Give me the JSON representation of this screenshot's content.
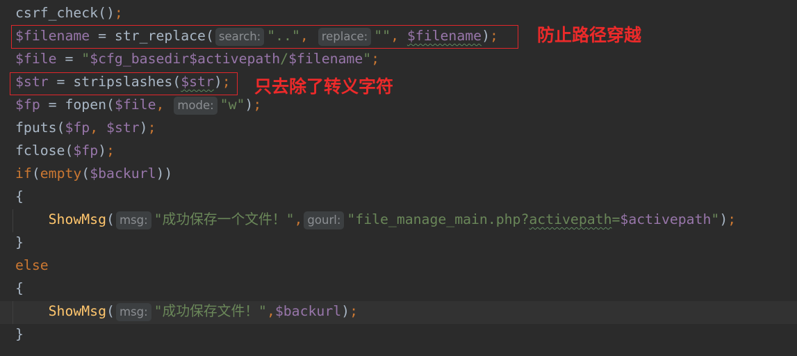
{
  "editor": {
    "theme": {
      "background": "#2b2b2b",
      "current_line": "#323232"
    },
    "lines": [
      {
        "tokens": [
          {
            "text": "csrf_check",
            "color": "#a9b7c6"
          },
          {
            "text": "()",
            "color": "#a9b7c6"
          },
          {
            "text": ";",
            "color": "#cc7832"
          }
        ]
      },
      {
        "tokens": [
          {
            "text": "$filename",
            "color": "#9876aa"
          },
          {
            "text": " = ",
            "color": "#a9b7c6"
          },
          {
            "text": "str_replace",
            "color": "#a9b7c6"
          },
          {
            "text": "(",
            "color": "#a9b7c6"
          },
          {
            "text": "search:",
            "hint": true
          },
          {
            "text": "\"..\"",
            "color": "#6a8759"
          },
          {
            "text": ", ",
            "color": "#cc7832"
          },
          {
            "text": "replace:",
            "hint": true
          },
          {
            "text": "\"\"",
            "color": "#6a8759"
          },
          {
            "text": ", ",
            "color": "#cc7832"
          },
          {
            "text": "$filename",
            "color": "#9876aa",
            "typo": true
          },
          {
            "text": ")",
            "color": "#a9b7c6"
          },
          {
            "text": ";",
            "color": "#cc7832"
          }
        ]
      },
      {
        "tokens": [
          {
            "text": "$file",
            "color": "#9876aa"
          },
          {
            "text": " = ",
            "color": "#a9b7c6"
          },
          {
            "text": "\"",
            "color": "#6a8759"
          },
          {
            "text": "$cfg_basedir",
            "color": "#9876aa"
          },
          {
            "text": "$activepath",
            "color": "#9876aa"
          },
          {
            "text": "/",
            "color": "#6a8759"
          },
          {
            "text": "$filename",
            "color": "#9876aa"
          },
          {
            "text": "\"",
            "color": "#6a8759"
          },
          {
            "text": ";",
            "color": "#cc7832"
          }
        ]
      },
      {
        "tokens": [
          {
            "text": "$str",
            "color": "#9876aa"
          },
          {
            "text": " = ",
            "color": "#a9b7c6"
          },
          {
            "text": "stripslashes",
            "color": "#a9b7c6"
          },
          {
            "text": "(",
            "color": "#a9b7c6"
          },
          {
            "text": "$str",
            "color": "#9876aa",
            "typo": true
          },
          {
            "text": ")",
            "color": "#a9b7c6"
          },
          {
            "text": ";",
            "color": "#cc7832"
          }
        ]
      },
      {
        "tokens": [
          {
            "text": "$fp",
            "color": "#9876aa"
          },
          {
            "text": " = ",
            "color": "#a9b7c6"
          },
          {
            "text": "fopen",
            "color": "#a9b7c6"
          },
          {
            "text": "(",
            "color": "#a9b7c6"
          },
          {
            "text": "$file",
            "color": "#9876aa"
          },
          {
            "text": ", ",
            "color": "#cc7832"
          },
          {
            "text": "mode:",
            "hint": true
          },
          {
            "text": "\"w\"",
            "color": "#6a8759"
          },
          {
            "text": ")",
            "color": "#a9b7c6"
          },
          {
            "text": ";",
            "color": "#cc7832"
          }
        ]
      },
      {
        "tokens": [
          {
            "text": "fputs",
            "color": "#a9b7c6"
          },
          {
            "text": "(",
            "color": "#a9b7c6"
          },
          {
            "text": "$fp",
            "color": "#9876aa"
          },
          {
            "text": ", ",
            "color": "#cc7832"
          },
          {
            "text": "$str",
            "color": "#9876aa"
          },
          {
            "text": ")",
            "color": "#a9b7c6"
          },
          {
            "text": ";",
            "color": "#cc7832"
          }
        ]
      },
      {
        "tokens": [
          {
            "text": "fclose",
            "color": "#a9b7c6"
          },
          {
            "text": "(",
            "color": "#a9b7c6"
          },
          {
            "text": "$fp",
            "color": "#9876aa"
          },
          {
            "text": ")",
            "color": "#a9b7c6"
          },
          {
            "text": ";",
            "color": "#cc7832"
          }
        ]
      },
      {
        "tokens": [
          {
            "text": "if",
            "color": "#cc7832"
          },
          {
            "text": "(",
            "color": "#a9b7c6"
          },
          {
            "text": "empty",
            "color": "#cc7832"
          },
          {
            "text": "(",
            "color": "#a9b7c6"
          },
          {
            "text": "$backurl",
            "color": "#9876aa"
          },
          {
            "text": "))",
            "color": "#a9b7c6"
          }
        ]
      },
      {
        "tokens": [
          {
            "text": "{",
            "color": "#a9b7c6"
          }
        ]
      },
      {
        "tokens": [
          {
            "text": "    ShowMsg",
            "color": "#ffc66d"
          },
          {
            "text": "(",
            "color": "#a9b7c6"
          },
          {
            "text": "msg:",
            "hint": true
          },
          {
            "text": "\"成功保存一个文件！\"",
            "color": "#6a8759"
          },
          {
            "text": ",",
            "color": "#cc7832"
          },
          {
            "text": "gourl:",
            "hint": true
          },
          {
            "text": "\"file_manage_main.php?",
            "color": "#6a8759"
          },
          {
            "text": "activepath",
            "color": "#6a8759",
            "typo": true
          },
          {
            "text": "=",
            "color": "#6a8759"
          },
          {
            "text": "$activepath",
            "color": "#9876aa"
          },
          {
            "text": "\"",
            "color": "#6a8759"
          },
          {
            "text": ")",
            "color": "#a9b7c6"
          },
          {
            "text": ";",
            "color": "#cc7832"
          }
        ]
      },
      {
        "tokens": [
          {
            "text": "}",
            "color": "#a9b7c6"
          }
        ]
      },
      {
        "tokens": [
          {
            "text": "else",
            "color": "#cc7832"
          }
        ]
      },
      {
        "tokens": [
          {
            "text": "{",
            "color": "#a9b7c6"
          }
        ]
      },
      {
        "current": true,
        "tokens": [
          {
            "text": "    ShowMsg",
            "color": "#ffc66d"
          },
          {
            "text": "(",
            "color": "#a9b7c6"
          },
          {
            "text": "msg:",
            "hint": true
          },
          {
            "text": "\"成功保存文件！\"",
            "color": "#6a8759"
          },
          {
            "text": ",",
            "color": "#cc7832"
          },
          {
            "text": "$backurl",
            "color": "#9876aa"
          },
          {
            "text": ")",
            "color": "#a9b7c6"
          },
          {
            "text": ";",
            "color": "#cc7832"
          }
        ]
      },
      {
        "tokens": [
          {
            "text": "}",
            "color": "#a9b7c6"
          }
        ]
      }
    ]
  },
  "annotations": [
    {
      "text": "防止路径穿越",
      "color": "#ec2a2a"
    },
    {
      "text": "只去除了转义字符",
      "color": "#ec2a2a"
    }
  ]
}
